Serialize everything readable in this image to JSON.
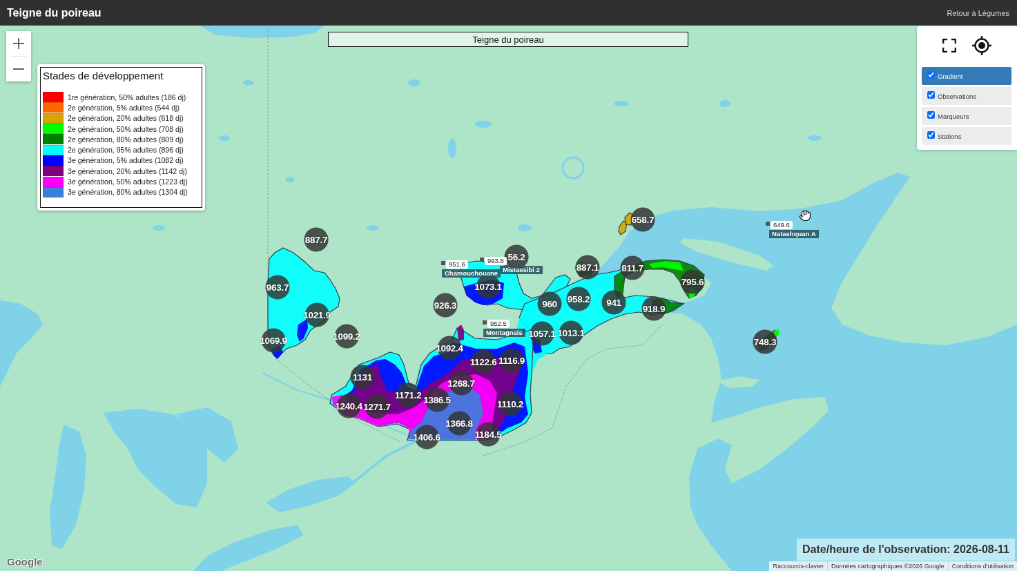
{
  "header": {
    "title": "Teigne du poireau",
    "back_link": "Retour à Légumes"
  },
  "map": {
    "title": "Teigne du poireau",
    "legend": {
      "title": "Stades de développement",
      "items": [
        {
          "label": "1re génération, 50% adultes (186 dj)",
          "color": "#ff0000"
        },
        {
          "label": "2e génération, 5% adultes (544 dj)",
          "color": "#ff6600"
        },
        {
          "label": "2e génération, 20% adultes (618 dj)",
          "color": "#d4a600"
        },
        {
          "label": "2e génération, 50% adultes (708 dj)",
          "color": "#00ff00"
        },
        {
          "label": "2e génération, 80% adultes (809 dj)",
          "color": "#008000"
        },
        {
          "label": "2e génération, 95% adultes (896 dj)",
          "color": "#00ffff"
        },
        {
          "label": "3e génération, 5% adultes (1082 dj)",
          "color": "#0000ff"
        },
        {
          "label": "3e génération, 20% adultes (1142 dj)",
          "color": "#800080"
        },
        {
          "label": "3e génération, 50% adultes (1223 dj)",
          "color": "#ff00ff"
        },
        {
          "label": "3e génération, 80% adultes (1304 dj)",
          "color": "#3a7fdb"
        }
      ]
    },
    "layers": [
      {
        "label": "Gradient",
        "checked": true,
        "selected": true
      },
      {
        "label": "Observations",
        "checked": true,
        "selected": false
      },
      {
        "label": "Marqueurs",
        "checked": true,
        "selected": false
      },
      {
        "label": "Stations",
        "checked": true,
        "selected": false
      }
    ],
    "markers": [
      {
        "value": "658.7"
      },
      {
        "value": "887.7"
      },
      {
        "value": "56.2"
      },
      {
        "value": "887.1"
      },
      {
        "value": "811.7"
      },
      {
        "value": "963.7"
      },
      {
        "value": "1073.1"
      },
      {
        "value": "795.6"
      },
      {
        "value": "926.3"
      },
      {
        "value": "960"
      },
      {
        "value": "958.2"
      },
      {
        "value": "941"
      },
      {
        "value": "1021.9"
      },
      {
        "value": "918.9"
      },
      {
        "value": "1069.9"
      },
      {
        "value": "1099.2"
      },
      {
        "value": "1057.1"
      },
      {
        "value": "1013.1"
      },
      {
        "value": "1092.4"
      },
      {
        "value": "748.3"
      },
      {
        "value": "1122.6"
      },
      {
        "value": "1116.9"
      },
      {
        "value": "1131"
      },
      {
        "value": "1268.7"
      },
      {
        "value": "1171.2"
      },
      {
        "value": "1240.4"
      },
      {
        "value": "1271.7"
      },
      {
        "value": "1386.5"
      },
      {
        "value": "1110.2"
      },
      {
        "value": "1366.8"
      },
      {
        "value": "1406.6"
      },
      {
        "value": "1184.5"
      }
    ],
    "stations": [
      {
        "value": "951.6",
        "name": "Chamouchouane"
      },
      {
        "value": "993.8",
        "name": "Mistassibi 2"
      },
      {
        "value": "952.5",
        "name": "Montagnais"
      },
      {
        "value": "649.6",
        "name": "Natashquan A"
      }
    ],
    "observation_date": "Date/heure de l'observation: 2026-08-11",
    "logo": "Google",
    "attribution": [
      "Raccourcis-clavier",
      "Données cartographiques ©2026 Google",
      "Conditions d'utilisation"
    ]
  }
}
